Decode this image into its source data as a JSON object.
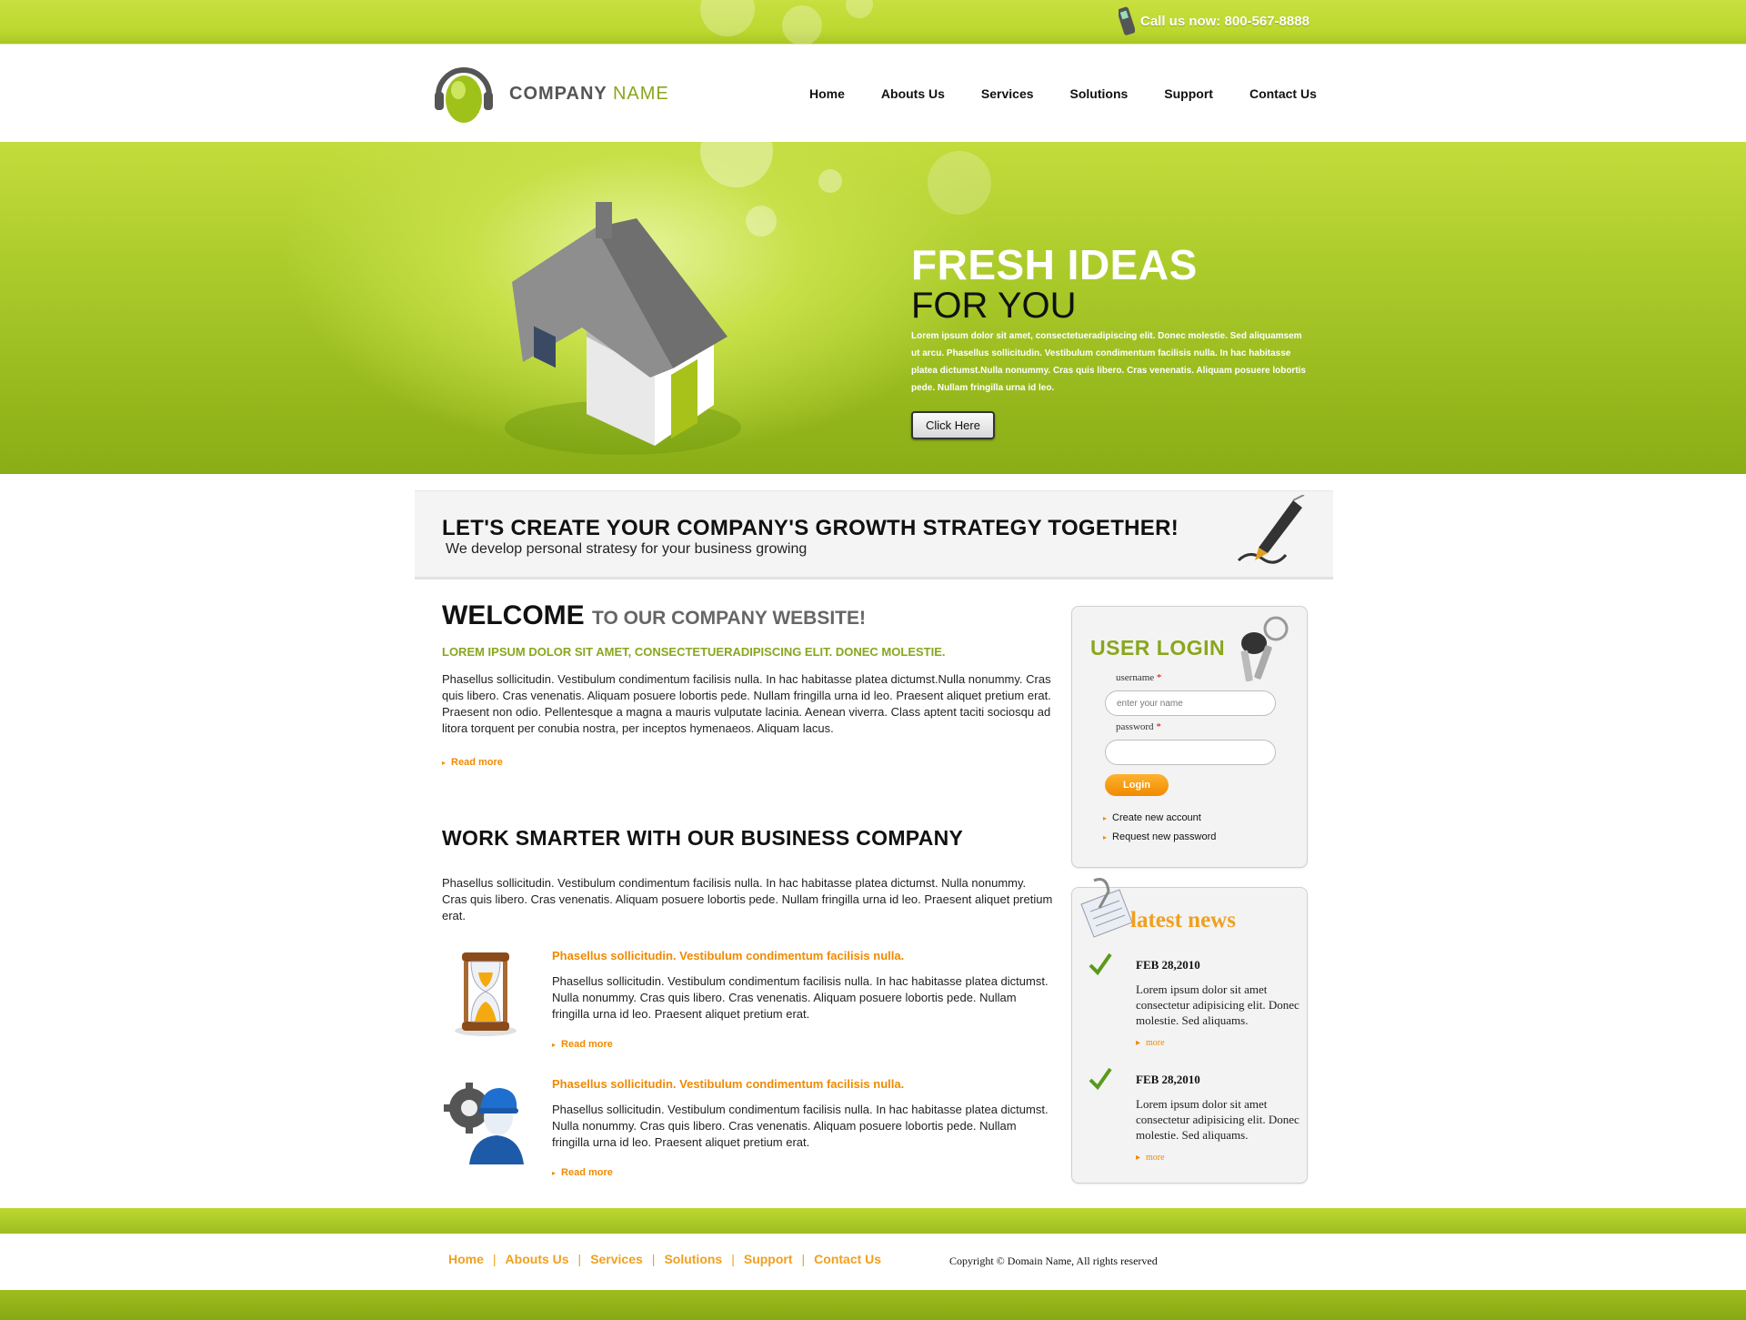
{
  "topbar": {
    "call_text": "Call us now: 800-567-8888"
  },
  "header": {
    "logo_word1": "COMPANY",
    "logo_word2": "NAME",
    "nav": [
      "Home",
      "Abouts Us",
      "Services",
      "Solutions",
      "Support",
      "Contact Us"
    ]
  },
  "hero": {
    "title1": "FRESH IDEAS",
    "title2": "FOR YOU",
    "text": "Lorem ipsum dolor sit amet, consectetueradipiscing elit. Donec molestie. Sed aliquamsem ut arcu. Phasellus sollicitudin. Vestibulum condimentum facilisis nulla. In hac habitasse platea dictumst.Nulla nonummy. Cras quis libero. Cras venenatis. Aliquam posuere lobortis pede. Nullam fringilla urna id leo.",
    "button": "Click Here"
  },
  "banner": {
    "title": "LET'S CREATE YOUR COMPANY'S GROWTH STRATEGY TOGETHER!",
    "subtitle": "We develop personal stratesy for your business growing"
  },
  "welcome": {
    "title": "WELCOME",
    "title_sub": "TO OUR COMPANY WEBSITE!",
    "lead": "LOREM IPSUM DOLOR SIT AMET, CONSECTETUERADIPISCING ELIT. DONEC MOLESTIE.",
    "text": "Phasellus sollicitudin. Vestibulum condimentum facilisis nulla. In hac habitasse platea dictumst.Nulla nonummy. Cras quis libero. Cras venenatis. Aliquam posuere lobortis pede. Nullam fringilla urna id leo. Praesent aliquet pretium erat. Praesent non odio. Pellentesque a magna a mauris vulputate lacinia. Aenean viverra. Class aptent taciti sociosqu ad litora torquent per conubia nostra, per inceptos hymenaeos. Aliquam lacus.",
    "read_more": "Read more"
  },
  "smarter": {
    "title": "WORK SMARTER WITH OUR BUSINESS COMPANY",
    "text": "Phasellus sollicitudin. Vestibulum condimentum facilisis nulla. In hac habitasse platea dictumst. Nulla nonummy. Cras quis libero. Cras venenatis. Aliquam posuere lobortis pede. Nullam fringilla urna id leo. Praesent aliquet pretium erat.",
    "features": [
      {
        "icon": "hourglass-icon",
        "title": "Phasellus sollicitudin. Vestibulum condimentum facilisis nulla.",
        "text": "Phasellus sollicitudin. Vestibulum condimentum facilisis nulla. In hac habitasse platea dictumst. Nulla nonummy. Cras quis libero. Cras venenatis. Aliquam posuere lobortis pede. Nullam fringilla urna id leo. Praesent aliquet pretium erat.",
        "read_more": "Read more"
      },
      {
        "icon": "worker-gear-icon",
        "title": "Phasellus sollicitudin. Vestibulum condimentum facilisis nulla.",
        "text": "Phasellus sollicitudin. Vestibulum condimentum facilisis nulla. In hac habitasse platea dictumst. Nulla nonummy. Cras quis libero. Cras venenatis. Aliquam posuere lobortis pede. Nullam fringilla urna id leo. Praesent aliquet pretium erat.",
        "read_more": "Read more"
      }
    ]
  },
  "login": {
    "title": "USER LOGIN",
    "username_label": "username",
    "username_placeholder": "enter your name",
    "password_label": "password",
    "required_mark": "*",
    "button": "Login",
    "create_account": "Create new account",
    "request_password": "Request new password"
  },
  "news": {
    "title": "latest news",
    "items": [
      {
        "date": "FEB 28,2010",
        "text": "Lorem ipsum dolor sit amet consectetur adipisicing elit. Donec molestie. Sed aliquams.",
        "more": "more"
      },
      {
        "date": "FEB 28,2010",
        "text": "Lorem ipsum dolor sit amet consectetur adipisicing elit. Donec molestie. Sed aliquams.",
        "more": "more"
      }
    ]
  },
  "footer": {
    "links": [
      "Home",
      "Abouts Us",
      "Services",
      "Solutions",
      "Support",
      "Contact Us"
    ],
    "separator": "|",
    "copyright": "Copyright © Domain Name, All rights reserved"
  },
  "colors": {
    "accent_green": "#8aa61e",
    "lime_bar": "#bcd830",
    "orange": "#f08a00"
  }
}
